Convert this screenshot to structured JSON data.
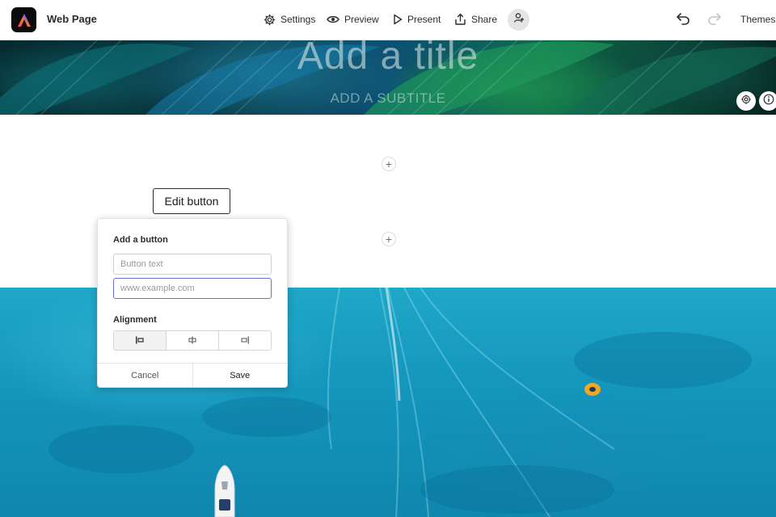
{
  "app": {
    "logo_icon": "adobe-express-logo-icon",
    "doc_title": "Web Page"
  },
  "toolbar": {
    "settings_label": "Settings",
    "preview_label": "Preview",
    "present_label": "Present",
    "share_label": "Share",
    "themes_label": "Themes",
    "icons": {
      "settings": "gear-icon",
      "preview": "eye-icon",
      "present": "play-icon",
      "share": "share-icon",
      "collaborator": "add-person-icon",
      "undo": "undo-icon",
      "redo": "redo-icon"
    }
  },
  "hero": {
    "title_placeholder": "Add a title",
    "subtitle_placeholder": "ADD A SUBTITLE",
    "icons": {
      "settings": "gear-icon",
      "info": "info-icon"
    }
  },
  "content": {
    "add_block_symbol": "+",
    "edit_button_label": "Edit button"
  },
  "popup": {
    "heading": "Add a button",
    "button_text_placeholder": "Button text",
    "button_text_value": "",
    "url_placeholder": "www.example.com",
    "url_value": "",
    "alignment_label": "Alignment",
    "alignment_options": [
      "left",
      "center",
      "right"
    ],
    "alignment_selected": "left",
    "cancel_label": "Cancel",
    "save_label": "Save"
  },
  "colors": {
    "accent_focus": "#6e6ed6",
    "text": "#2c2c2c",
    "ocean": "#1597bd"
  }
}
